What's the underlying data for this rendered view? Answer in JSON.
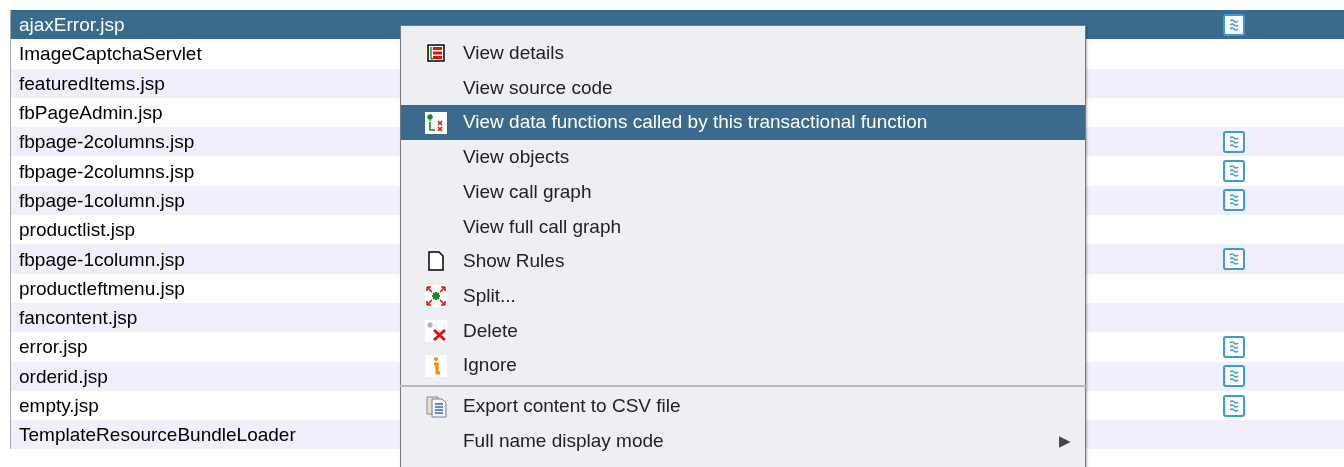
{
  "table": {
    "rows": [
      {
        "name": "ajaxError.jsp",
        "has_icon": true,
        "selected": true
      },
      {
        "name": "ImageCaptchaServlet",
        "has_icon": false,
        "selected": false
      },
      {
        "name": "featuredItems.jsp",
        "has_icon": false,
        "selected": false
      },
      {
        "name": "fbPageAdmin.jsp",
        "has_icon": false,
        "selected": false
      },
      {
        "name": "fbpage-2columns.jsp",
        "has_icon": true,
        "selected": false
      },
      {
        "name": "fbpage-2columns.jsp",
        "has_icon": true,
        "selected": false
      },
      {
        "name": "fbpage-1column.jsp",
        "has_icon": true,
        "selected": false
      },
      {
        "name": "productlist.jsp",
        "has_icon": false,
        "selected": false
      },
      {
        "name": "fbpage-1column.jsp",
        "has_icon": true,
        "selected": false
      },
      {
        "name": "productleftmenu.jsp",
        "has_icon": false,
        "selected": false
      },
      {
        "name": "fancontent.jsp",
        "has_icon": false,
        "selected": false
      },
      {
        "name": "error.jsp",
        "has_icon": true,
        "selected": false
      },
      {
        "name": "orderid.jsp",
        "has_icon": true,
        "selected": false
      },
      {
        "name": "empty.jsp",
        "has_icon": true,
        "selected": false
      },
      {
        "name": "TemplateResourceBundleLoader",
        "has_icon": false,
        "selected": false
      }
    ]
  },
  "context_menu": {
    "items": [
      {
        "label": "View details",
        "selected": false,
        "separator_before": false
      },
      {
        "label": "View source code",
        "selected": false,
        "separator_before": false
      },
      {
        "label": "View data functions called by this transactional function",
        "selected": true,
        "separator_before": false
      },
      {
        "label": "View objects",
        "selected": false,
        "separator_before": false
      },
      {
        "label": "View call graph",
        "selected": false,
        "separator_before": false
      },
      {
        "label": "View full call graph",
        "selected": false,
        "separator_before": false
      },
      {
        "label": "Show Rules",
        "selected": false,
        "separator_before": false
      },
      {
        "label": "Split...",
        "selected": false,
        "separator_before": false
      },
      {
        "label": "Delete",
        "selected": false,
        "separator_before": false
      },
      {
        "label": "Ignore",
        "selected": false,
        "separator_before": false
      },
      {
        "label": "Export content to CSV file",
        "selected": false,
        "separator_before": true
      },
      {
        "label": "Full name display mode",
        "selected": false,
        "separator_before": false,
        "submenu_arrow": "▶"
      }
    ]
  }
}
